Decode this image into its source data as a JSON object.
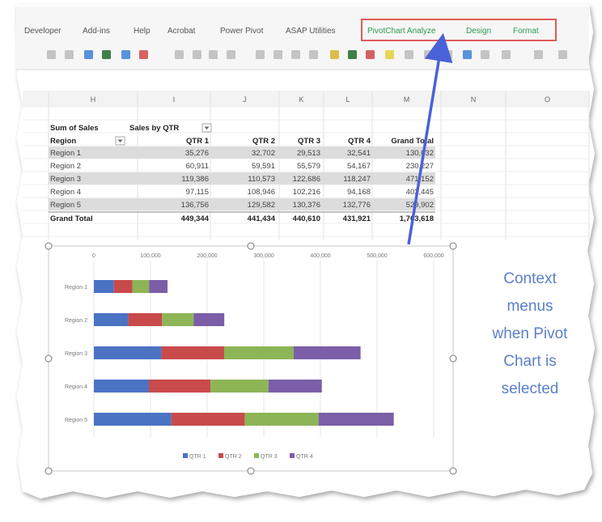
{
  "ribbon": {
    "tabs": [
      "Developer",
      "Add-ins",
      "Help",
      "Acrobat",
      "Power Pivot",
      "ASAP Utilities"
    ],
    "context_tabs": [
      "PivotChart Analyze",
      "Design",
      "Format"
    ],
    "highlight_color": "#e05a5a"
  },
  "sheet": {
    "columns": [
      "H",
      "I",
      "J",
      "K",
      "L",
      "M",
      "N",
      "O"
    ],
    "pivot": {
      "header_label": "Sum of Sales",
      "filter_label": "Sales by QTR",
      "row_label": "Region",
      "col_headers": [
        "QTR 1",
        "QTR 2",
        "QTR 3",
        "QTR 4",
        "Grand Total"
      ],
      "rows": [
        {
          "label": "Region 1",
          "values": [
            "35,276",
            "32,702",
            "29,513",
            "32,541",
            "130,032"
          ]
        },
        {
          "label": "Region 2",
          "values": [
            "60,911",
            "59,591",
            "55,579",
            "54,167",
            "230,227"
          ]
        },
        {
          "label": "Region 3",
          "values": [
            "119,386",
            "110,573",
            "122,686",
            "118,247",
            "471,152"
          ]
        },
        {
          "label": "Region 4",
          "values": [
            "97,115",
            "108,946",
            "102,216",
            "94,168",
            "402,445"
          ]
        },
        {
          "label": "Region 5",
          "values": [
            "136,756",
            "129,582",
            "130,376",
            "132,776",
            "529,902"
          ]
        }
      ],
      "total": {
        "label": "Grand Total",
        "values": [
          "449,344",
          "441,434",
          "440,610",
          "431,921",
          "1,763,618"
        ]
      }
    }
  },
  "chart_data": {
    "type": "bar",
    "stacked": true,
    "orientation": "horizontal",
    "categories": [
      "Region 1",
      "Region 2",
      "Region 3",
      "Region 4",
      "Region 5"
    ],
    "series": [
      {
        "name": "QTR 1",
        "color": "#4a73c4",
        "values": [
          35276,
          60911,
          119386,
          97115,
          136756
        ]
      },
      {
        "name": "QTR 2",
        "color": "#c94a4a",
        "values": [
          32702,
          59591,
          110573,
          108946,
          129582
        ]
      },
      {
        "name": "QTR 3",
        "color": "#8db556",
        "values": [
          29513,
          55579,
          122686,
          102216,
          130376
        ]
      },
      {
        "name": "QTR 4",
        "color": "#7b5ea7",
        "values": [
          32541,
          54167,
          118247,
          94168,
          132776
        ]
      }
    ],
    "xlim": [
      0,
      600000
    ],
    "x_ticks": [
      "0",
      "100,000",
      "200,000",
      "300,000",
      "400,000",
      "500,000",
      "600,000"
    ],
    "grid": true,
    "legend": "bottom"
  },
  "callout": {
    "lines": [
      "Context",
      "menus",
      "when Pivot",
      "Chart is",
      "selected"
    ],
    "color": "#5b7fc8"
  },
  "arrow_color": "#4a62d8"
}
